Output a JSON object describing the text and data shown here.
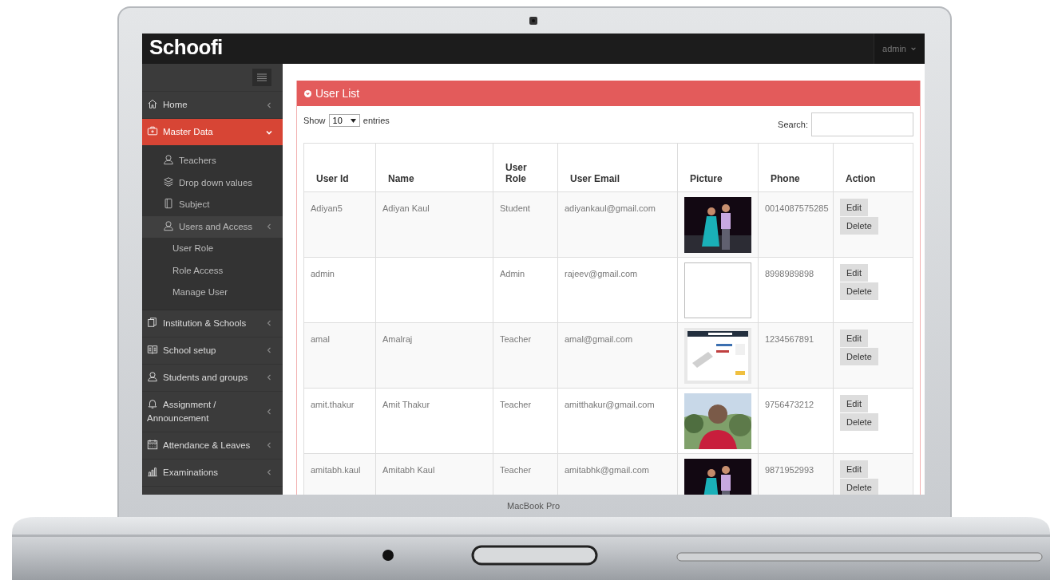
{
  "app": {
    "logo": "Schoofi",
    "user_menu": "admin"
  },
  "sidebar": {
    "items": [
      {
        "label": "Home",
        "selected": false,
        "expanded": false
      },
      {
        "label": "Master Data",
        "selected": true,
        "expanded": true,
        "children": [
          {
            "label": "Teachers",
            "selected": false
          },
          {
            "label": "Drop down values",
            "selected": false
          },
          {
            "label": "Subject",
            "selected": false
          },
          {
            "label": "Users and Access",
            "selected": true,
            "expanded": false,
            "children": [
              {
                "label": "User Role",
                "selected": false
              },
              {
                "label": "Role Access",
                "selected": false
              },
              {
                "label": "Manage User",
                "selected": false
              }
            ]
          }
        ]
      },
      {
        "label": "Institution & Schools",
        "selected": false,
        "expanded": false
      },
      {
        "label": "School setup",
        "selected": false,
        "expanded": false
      },
      {
        "label": "Students and groups",
        "selected": false,
        "expanded": false
      },
      {
        "label": "Assignment / Announcement",
        "selected": false,
        "expanded": false
      },
      {
        "label": "Attendance & Leaves",
        "selected": false,
        "expanded": false
      },
      {
        "label": "Examinations",
        "selected": false,
        "expanded": false
      }
    ]
  },
  "panel": {
    "title": "User List",
    "length": {
      "label_before": "Show",
      "value": "10",
      "label_after": "entries"
    },
    "search": {
      "label": "Search:"
    }
  },
  "table": {
    "columns": [
      "User Id",
      "Name",
      "User Role",
      "User Email",
      "Picture",
      "Phone",
      "Action"
    ],
    "rows": [
      {
        "user_id": "Adiyan5",
        "name": "Adiyan Kaul",
        "role": "Student",
        "email": "adiyankaul@gmail.com",
        "picture": {
          "kind": "picture"
        },
        "phone": "0014087575285",
        "actions": [
          "Edit",
          "Delete"
        ]
      },
      {
        "user_id": "admin",
        "role": "Admin",
        "email": "rajeev@gmail.com",
        "picture": {
          "kind": "empty"
        },
        "phone": "8998989898",
        "actions": [
          "Edit",
          "Delete"
        ]
      },
      {
        "user_id": "amal",
        "name": "Amalraj",
        "role": "Teacher",
        "email": "amal@gmail.com",
        "picture": {
          "kind": "picture"
        },
        "phone": "1234567891",
        "actions": [
          "Edit",
          "Delete"
        ]
      },
      {
        "user_id": "amit.thakur",
        "name": "Amit Thakur",
        "role": "Teacher",
        "email": "amitthakur@gmail.com",
        "picture": {
          "kind": "picture"
        },
        "phone": "9756473212",
        "actions": [
          "Edit",
          "Delete"
        ]
      },
      {
        "user_id": "amitabh.kaul",
        "name": "Amitabh Kaul",
        "role": "Teacher",
        "email": "amitabhk@gmail.com",
        "picture": {
          "kind": "picture"
        },
        "phone": "9871952993",
        "actions": [
          "Edit",
          "Delete"
        ]
      }
    ]
  },
  "device": {
    "label": "MacBook Pro"
  }
}
